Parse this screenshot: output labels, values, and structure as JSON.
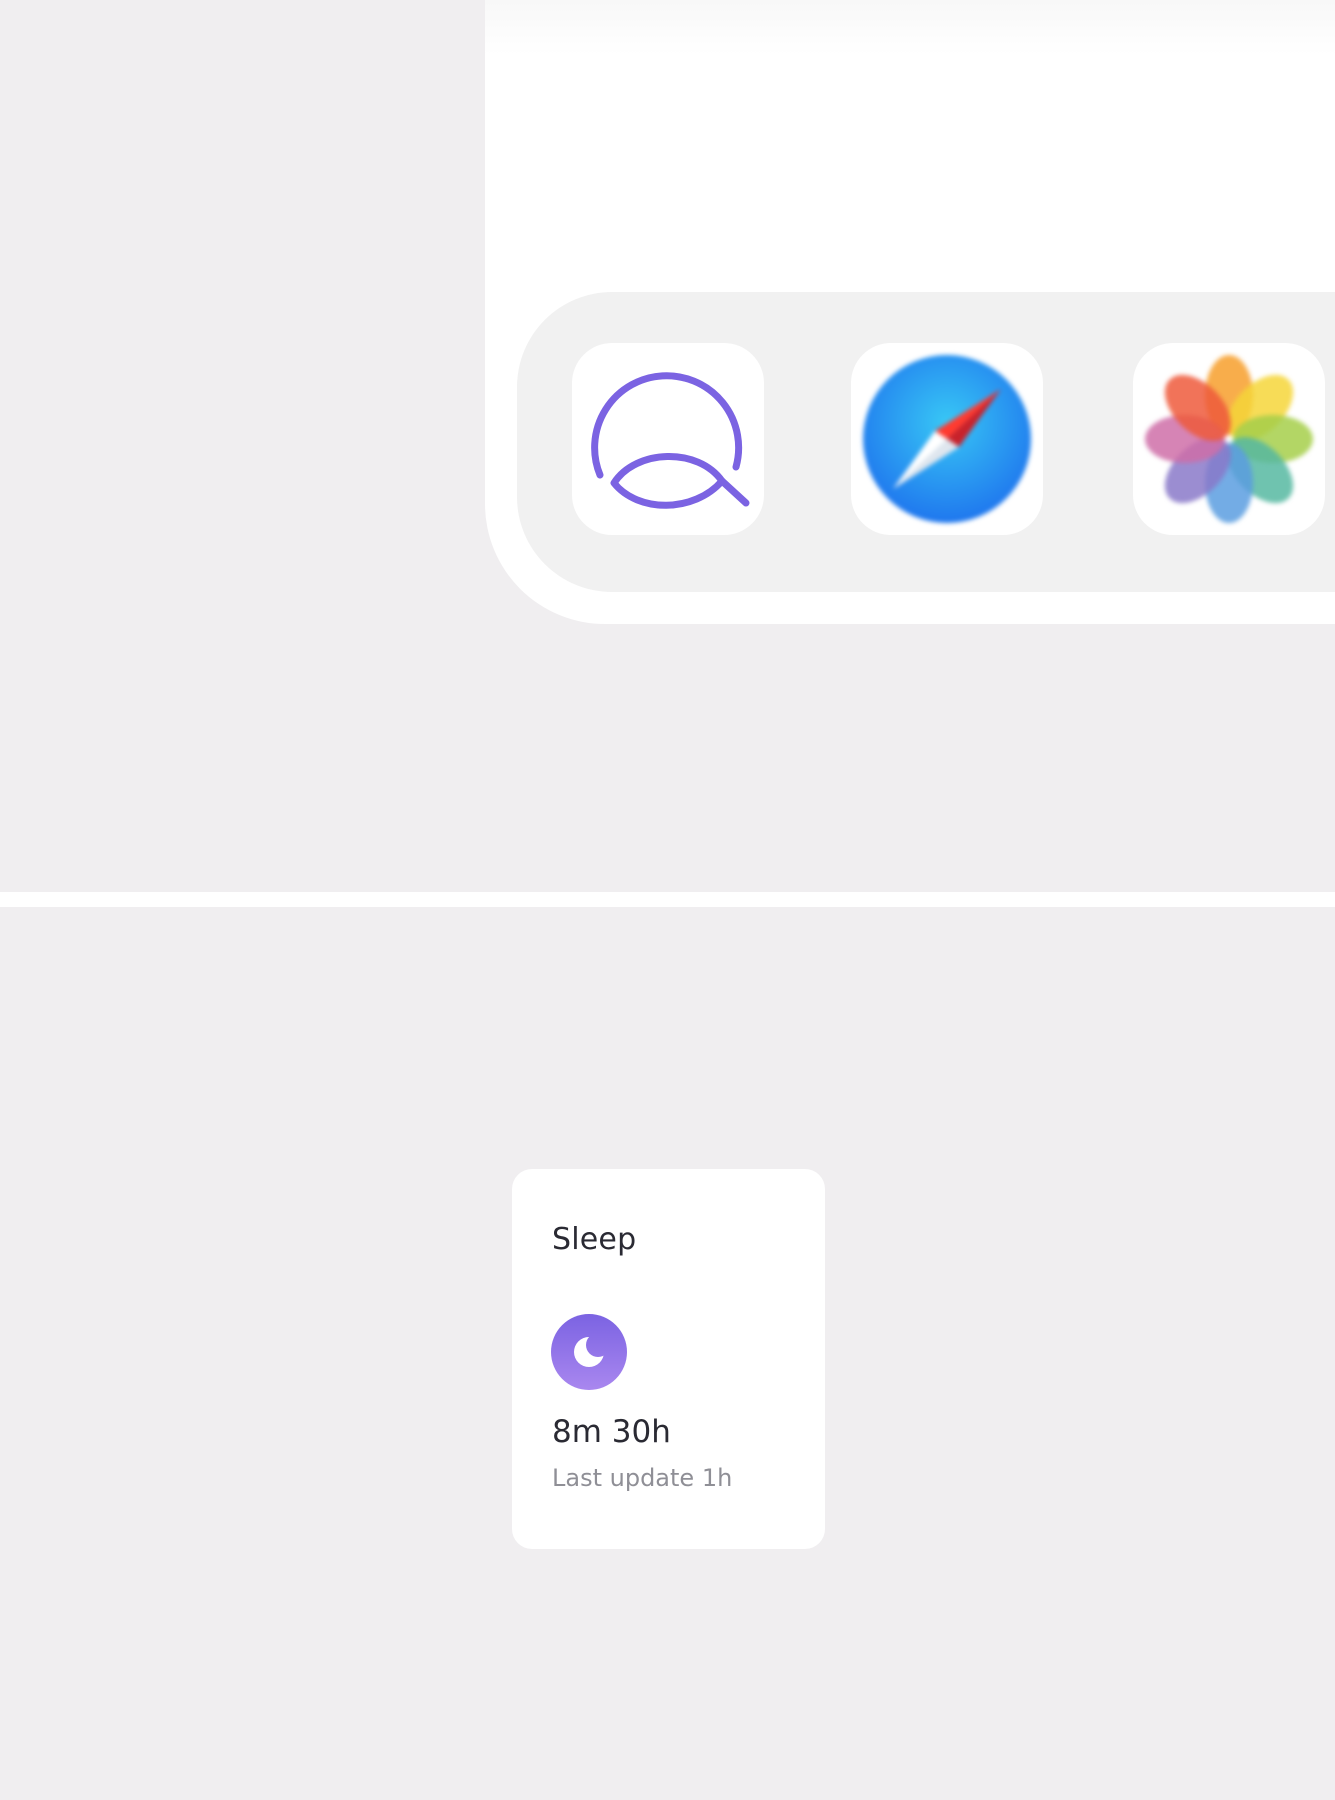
{
  "dock": {
    "apps": [
      {
        "name": "Q app",
        "icon": "q-logo-icon"
      },
      {
        "name": "Safari",
        "icon": "safari-compass-icon"
      },
      {
        "name": "Photos",
        "icon": "photos-flower-icon"
      }
    ]
  },
  "sleep_card": {
    "title": "Sleep",
    "icon": "moon-icon",
    "value": "8m 30h",
    "subtitle": "Last update 1h"
  },
  "colors": {
    "background": "#f0eef0",
    "accent_purple": "#7b63e2",
    "card_background": "#ffffff",
    "text_primary": "#2a2a33",
    "text_secondary": "#8f8f96"
  }
}
